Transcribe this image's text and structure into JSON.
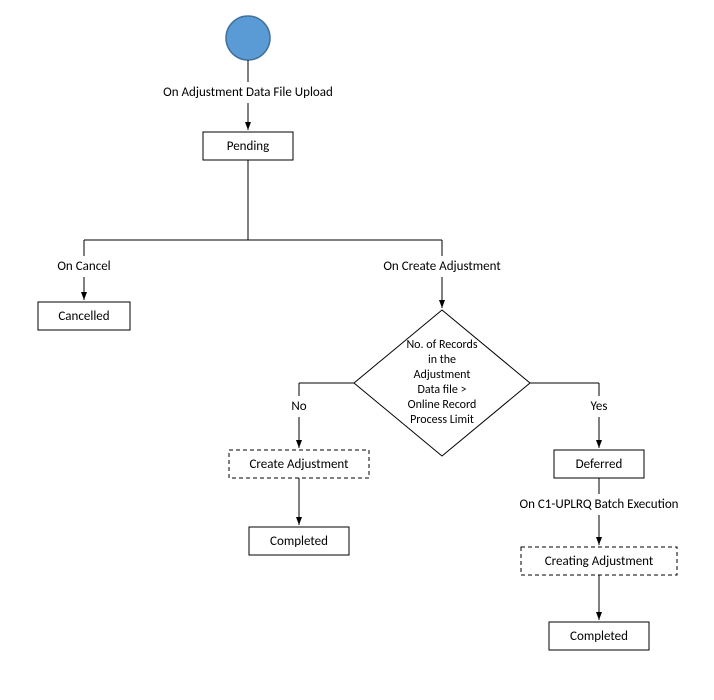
{
  "start_label": "On Adjustment Data File Upload",
  "state_pending": "Pending",
  "branch_cancel": "On Cancel",
  "state_cancelled": "Cancelled",
  "branch_create": "On Create Adjustment",
  "decision_line1": "No. of Records",
  "decision_line2": "in the",
  "decision_line3": "Adjustment",
  "decision_line4": "Data file >",
  "decision_line5": "Online Record",
  "decision_line6": "Process Limit",
  "decision_no": "No",
  "decision_yes": "Yes",
  "state_create_adjustment": "Create Adjustment",
  "state_completed_left": "Completed",
  "state_deferred": "Deferred",
  "batch_label": "On C1-UPLRQ Batch Execution",
  "state_creating_adjustment": "Creating Adjustment",
  "state_completed_right": "Completed"
}
